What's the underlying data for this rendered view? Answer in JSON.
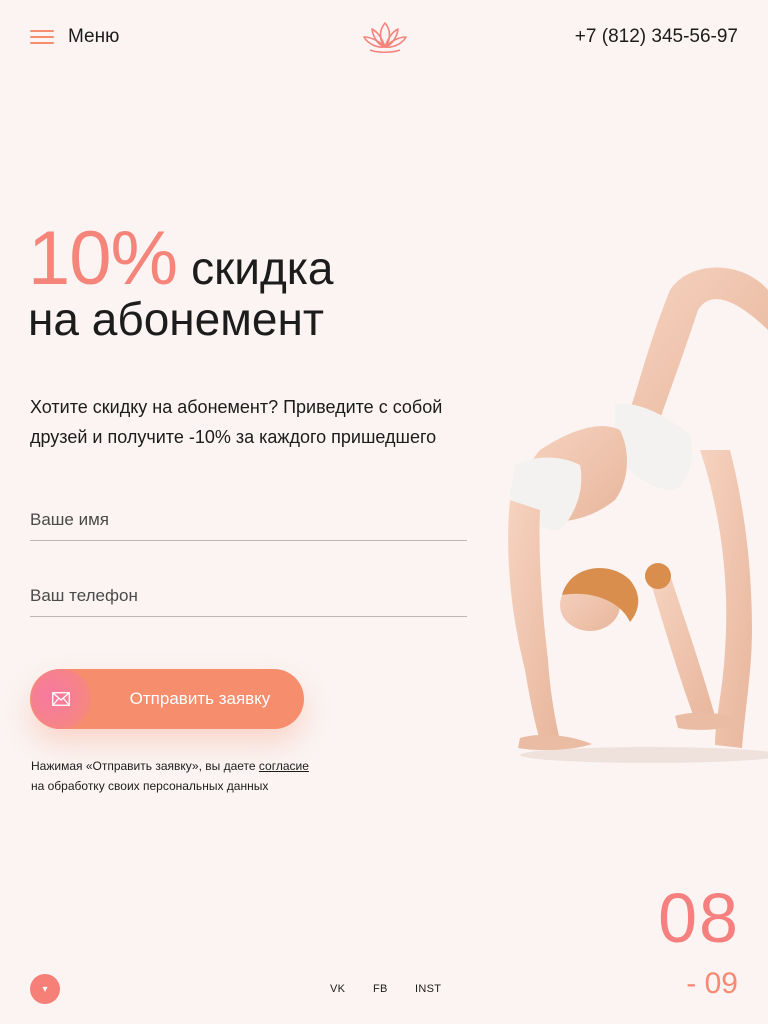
{
  "header": {
    "menu_label": "Меню",
    "phone": "+7 (812) 345-56-97",
    "logo_icon": "lotus-logo-icon"
  },
  "hero": {
    "discount": "10%",
    "title_part1": "скидка",
    "title_part2": "на абонемент",
    "description": "Хотите скидку на абонемент? Приведите с собой друзей и получите -10% за каждого пришедшего"
  },
  "form": {
    "name_placeholder": "Ваше имя",
    "phone_placeholder": "Ваш телефон",
    "submit_label": "Отправить заявку",
    "submit_icon": "envelope-icon",
    "consent_prefix": "Нажимая «Отправить заявку», вы даете",
    "consent_link": "согласие",
    "consent_suffix": "на обработку своих персональных данных"
  },
  "footer": {
    "scroll_icon": "▾",
    "social": [
      "VK",
      "FB",
      "INST"
    ]
  },
  "slider": {
    "current": "08",
    "total": "- 09"
  },
  "colors": {
    "background": "#fbf4f2",
    "accent": "#f68d6d",
    "accent_pink": "#f5857b",
    "text": "#1c1c1c"
  }
}
